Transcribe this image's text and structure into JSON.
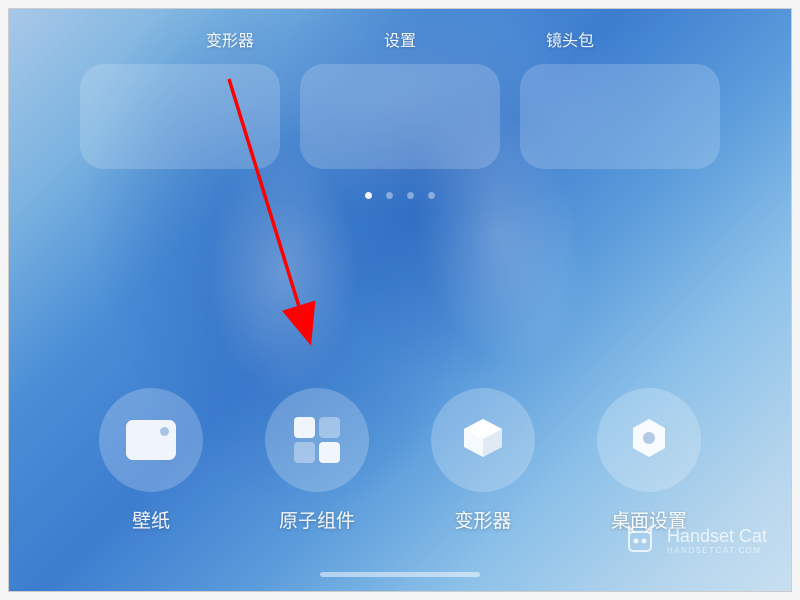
{
  "top_labels": {
    "morpher": "变形器",
    "settings": "设置",
    "lens_pack": "镜头包"
  },
  "page_indicator": {
    "total": 4,
    "active": 0
  },
  "bottom_buttons": {
    "wallpaper": {
      "label": "壁纸",
      "icon": "wallpaper-icon"
    },
    "widget": {
      "label": "原子组件",
      "icon": "widget-icon"
    },
    "morpher": {
      "label": "变形器",
      "icon": "cube-icon"
    },
    "desktop_settings": {
      "label": "桌面设置",
      "icon": "hexagon-icon"
    }
  },
  "annotation": {
    "arrow_color": "#ff0000",
    "target": "原子组件"
  },
  "watermark": {
    "title": "Handset Cat",
    "subtitle": "HANDSETCAT.COM"
  }
}
